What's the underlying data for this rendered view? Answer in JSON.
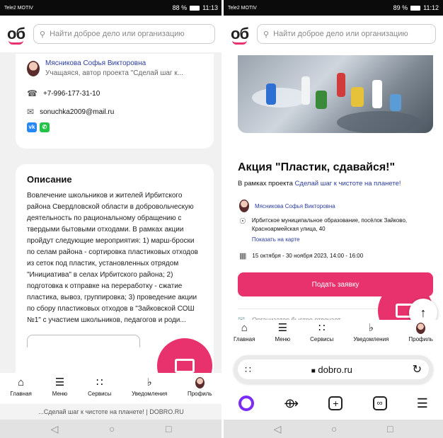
{
  "left": {
    "status": {
      "carrier": "Tele2\nMOTIV",
      "battery": "88 %",
      "time": "11:13"
    },
    "search_placeholder": "Найти доброе дело или организацию",
    "organizer": {
      "name": "Мясникова Софья Викторовна",
      "role": "Учащаяся, автор проекта \"Сделай шаг к...",
      "phone": "+7-996-177-31-10",
      "email": "sonuchka2009@mail.ru",
      "social": [
        "vk",
        "whatsapp"
      ]
    },
    "description": {
      "title": "Описание",
      "text": "Вовлечение школьников и жителей Ирбитского района Свердловской области в добровольческую деятельность по рациональному обращению с твердыми бытовыми отходами. В рамках акции пройдут следующие мероприятия: 1) марш-броски по селам района - сортировка пластиковых отходов из сеток под пластик, установленных отрядом \"Инициатива\" в селах Ирбитского района; 2) подготовка к отправке на переработку - сжатие пластика, вывоз, группировка; 3) проведение акции по сбору пластиковых отходов в \"Зайковской СОШ №1\" с участием школьников, педагогов и роди..."
    },
    "nav": [
      {
        "icon": "home-icon",
        "label": "Главная"
      },
      {
        "icon": "menu-icon",
        "label": "Меню"
      },
      {
        "icon": "services-icon",
        "label": "Сервисы"
      },
      {
        "icon": "bell-icon",
        "label": "Уведомления"
      },
      {
        "icon": "profile-icon",
        "label": "Профиль"
      }
    ],
    "browser_title": "...Сделай шаг к чистоте на планете! | DOBRO.RU"
  },
  "right": {
    "status": {
      "carrier": "Tele2\nMOTIV",
      "battery": "89 %",
      "time": "11:12"
    },
    "search_placeholder": "Найти доброе дело или организацию",
    "event": {
      "title": "Акция \"Пластик, сдавайся!\"",
      "project_prefix": "В рамках проекта",
      "project_link": "Сделай шаг к чистоте на планете!",
      "organizer": "Мясникова Софья Викторовна",
      "address": "Ирбитское муниципальное образование, посёлок Зайково, Красноармейская улица, 40",
      "map_link": "Показать на карте",
      "dates": "15 октября - 30 ноября 2023, 14:00 - 16:00",
      "apply_label": "Подать заявку",
      "notice": "Организатор быстро отвечает"
    },
    "nav": [
      {
        "icon": "home-icon",
        "label": "Главная"
      },
      {
        "icon": "menu-icon",
        "label": "Меню"
      },
      {
        "icon": "services-icon",
        "label": "Сервисы"
      },
      {
        "icon": "bell-icon",
        "label": "Уведомления"
      },
      {
        "icon": "profile-icon",
        "label": "Профиль"
      }
    ],
    "url": "dobro.ru",
    "colors": {
      "accent": "#e8326d",
      "link": "#2b3d9f",
      "assistant": "#7b2cf5"
    }
  }
}
